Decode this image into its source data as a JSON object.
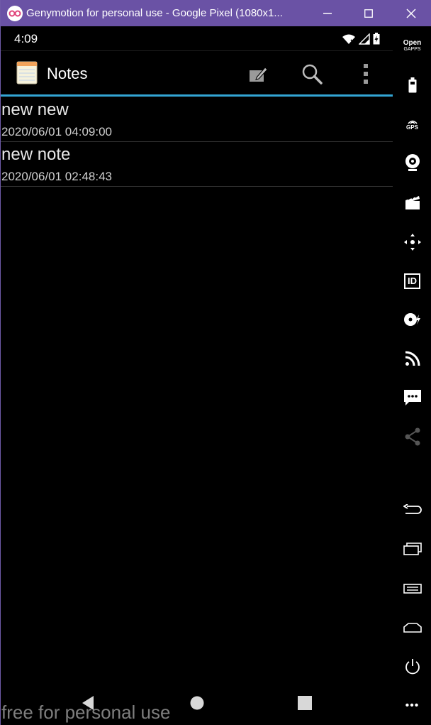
{
  "window": {
    "title": "Genymotion for personal use - Google Pixel (1080x1...",
    "minimize_glyph": "—",
    "close_glyph": "✕"
  },
  "statusbar": {
    "time": "4:09"
  },
  "actionbar": {
    "title": "Notes",
    "icons": [
      "notepad-icon",
      "compose-icon",
      "search-icon",
      "overflow-menu-icon"
    ]
  },
  "notes": [
    {
      "title": "new new",
      "date": "2020/06/01 04:09:00"
    },
    {
      "title": "new note",
      "date": "2020/06/01 02:48:43"
    }
  ],
  "side_toolbar": {
    "opengapps_top": "Open",
    "opengapps_bottom": "GAPPS",
    "gps_label": "GPS",
    "id_label": "ID",
    "more_glyph": "•••"
  },
  "watermark": "free for personal use",
  "colors": {
    "titlebar": "#6a52a5",
    "accent": "#33a5d4",
    "background": "#000000"
  }
}
